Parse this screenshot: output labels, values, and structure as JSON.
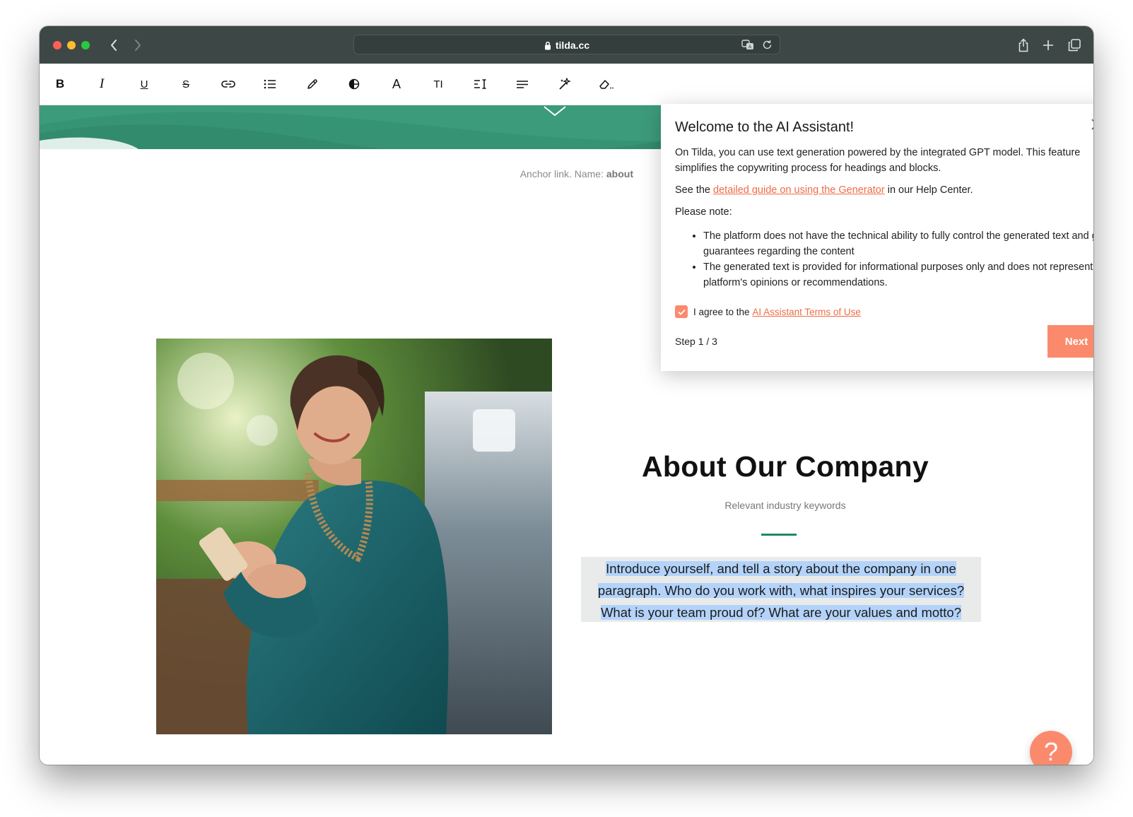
{
  "browser": {
    "url": "tilda.cc"
  },
  "toolbar": {
    "buttons": [
      {
        "name": "bold-button",
        "icon": "bold-icon",
        "glyph": "B"
      },
      {
        "name": "italic-button",
        "icon": "italic-icon",
        "glyph": "I"
      },
      {
        "name": "underline-button",
        "icon": "underline-icon",
        "glyph": "U"
      },
      {
        "name": "strikethrough-button",
        "icon": "strikethrough-icon",
        "glyph": "S"
      },
      {
        "name": "link-button",
        "icon": "link-icon"
      },
      {
        "name": "list-button",
        "icon": "bullet-list-icon"
      },
      {
        "name": "color-button",
        "icon": "pencil-icon"
      },
      {
        "name": "highlight-button",
        "icon": "contrast-icon"
      },
      {
        "name": "font-button",
        "icon": "font-icon",
        "glyph": "A"
      },
      {
        "name": "font-size-button",
        "icon": "text-size-icon",
        "glyph": "TI"
      },
      {
        "name": "line-height-button",
        "icon": "line-height-icon"
      },
      {
        "name": "align-button",
        "icon": "align-icon"
      },
      {
        "name": "ai-assistant-button",
        "icon": "sparkle-icon"
      },
      {
        "name": "clear-format-button",
        "icon": "eraser-icon"
      }
    ],
    "help_glyph": "?"
  },
  "page": {
    "anchor_prefix": "Anchor link. Name:",
    "anchor_name": "about",
    "heading": "About Our Company",
    "subheading": "Relevant industry keywords",
    "paragraph": "Introduce yourself, and tell a story about the company in one paragraph. Who do you work with, what inspires your services? What is your team proud of? What are your values and motto?",
    "help_button": "?",
    "colors": {
      "accent": "#3c9b7a",
      "cta": "#fb8a6d",
      "link": "#f06b46",
      "selection": "#b3d3fa"
    }
  },
  "modal": {
    "title": "Welcome to the AI Assistant!",
    "intro": "On Tilda, you can use text generation powered by the integrated GPT model. This feature simplifies the copywriting process for headings and blocks.",
    "guide_prefix": "See the",
    "guide_link": "detailed guide on using the Generator",
    "guide_suffix": "in our Help Center.",
    "note_label": "Please note:",
    "notes": [
      "The platform does not have the technical ability to fully control the generated text and gives no guarantees regarding the content",
      "The generated text is provided for informational purposes only and does not represent the platform's opinions or recommendations."
    ],
    "agree_prefix": "I agree to the",
    "agree_link": "AI Assistant Terms of Use",
    "agree_checked": true,
    "step": "Step 1 / 3",
    "next_label": "Next"
  }
}
